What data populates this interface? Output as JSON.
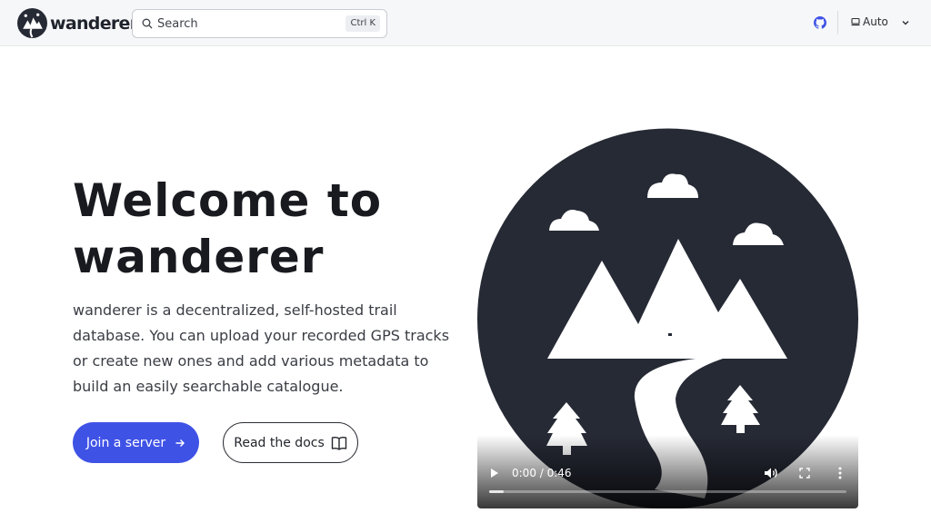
{
  "header": {
    "brand": "wanderer",
    "search": {
      "placeholder": "Search",
      "shortcut": "Ctrl K"
    },
    "theme_label": "Auto"
  },
  "hero": {
    "title_line1": "Welcome to",
    "title_line2": "wanderer",
    "description": "wanderer is a decentralized, self-hosted trail database. You can upload your recorded GPS tracks or create new ones and add various metadata to build an easily searchable catalogue.",
    "primary_button": "Join a server",
    "secondary_button": "Read the docs"
  },
  "video": {
    "time": "0:00 / 0:46",
    "progress_fraction": 0.04
  },
  "colors": {
    "accent": "#3f52e6",
    "dark": "#262a35"
  },
  "icons": {
    "brand": "wanderer-logo-icon",
    "search": "search-icon",
    "github": "github-icon",
    "theme": "monitor-icon",
    "dropdown": "chevron-down-icon",
    "join": "arrow-right-icon",
    "docs": "book-icon",
    "play": "play-icon",
    "volume": "volume-icon",
    "fullscreen": "fullscreen-icon",
    "more": "more-vertical-icon"
  }
}
